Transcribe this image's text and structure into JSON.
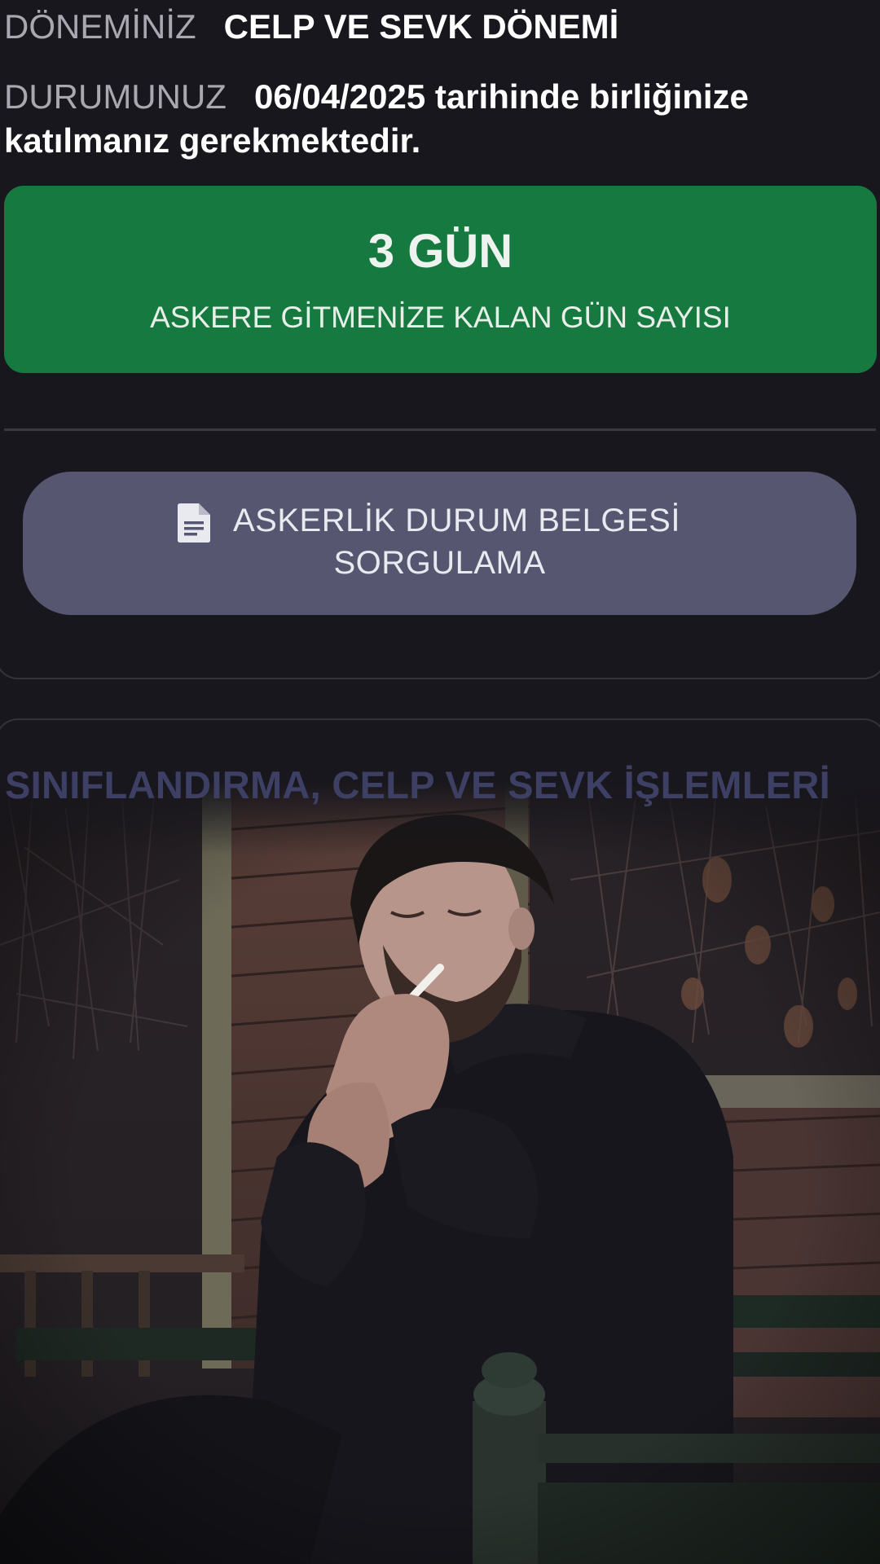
{
  "status": {
    "donem_label": "DÖNEMİNİZ",
    "donem_value": "CELP VE SEVK DÖNEMİ",
    "durum_label": "DURUMUNUZ",
    "durum_value": "06/04/2025 tarihinde birliğinize katılmanız gerekmektedir."
  },
  "countdown": {
    "days": "3 GÜN",
    "caption": "ASKERE GİTMENİZE KALAN GÜN SAYISI",
    "color": "#167a40"
  },
  "document_button": {
    "label_line1": "ASKERLİK DURUM BELGESİ",
    "label_line2": "SORGULAMA",
    "icon": "document-icon",
    "color": "#565670"
  },
  "section": {
    "heading": "SINIFLANDIRMA, CELP VE SEVK İŞLEMLERİ"
  },
  "photo": {
    "subject": "man-lighting-cigarette-photo"
  }
}
